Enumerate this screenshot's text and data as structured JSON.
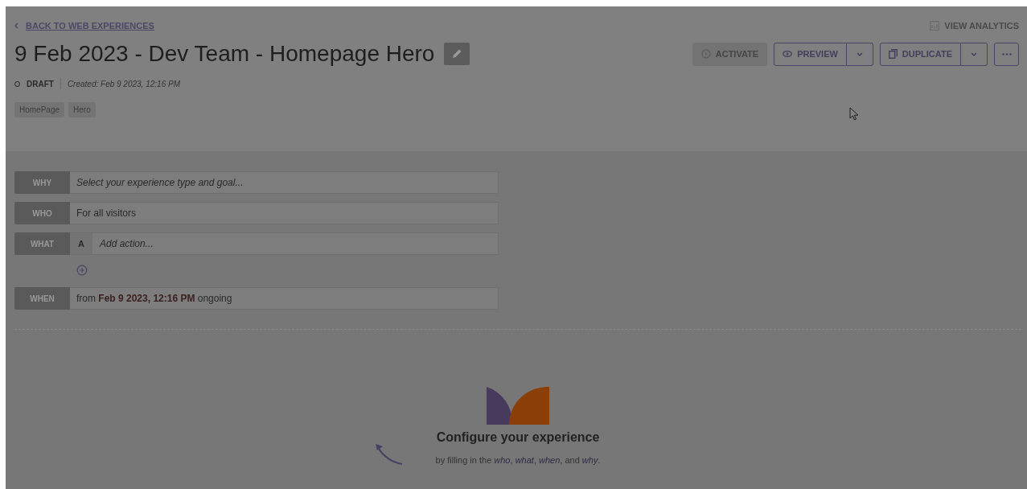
{
  "back_link": "BACK TO WEB EXPERIENCES",
  "view_analytics": "VIEW ANALYTICS",
  "title": "9 Feb 2023 - Dev Team - Homepage Hero",
  "buttons": [
    {
      "kind": "activate",
      "label": "ACTIVATE",
      "disabled": true
    },
    {
      "kind": "preview",
      "label": "PREVIEW",
      "disabled": false
    },
    {
      "kind": "duplicate",
      "label": "DUPLICATE",
      "disabled": false
    },
    {
      "kind": "more",
      "disabled": false
    }
  ],
  "status": {
    "label": "DRAFT",
    "created": "Created: Feb 9 2023, 12:16 PM"
  },
  "tags": [
    "HomePage",
    "Hero"
  ],
  "rows": [
    {
      "kind": "placeholder",
      "label": "WHY",
      "text": "Select your experience type and goal..."
    },
    {
      "kind": "value",
      "label": "WHO",
      "text": "For all visitors"
    },
    {
      "kind": "action",
      "label": "WHAT",
      "badge": "A",
      "text": "Add action..."
    },
    {
      "kind": "add"
    },
    {
      "kind": "value",
      "label": "WHEN",
      "text": "from **Feb 9 2023, 12:16 PM** ongoing"
    }
  ],
  "empty_state": {
    "title": "Configure your experience",
    "text": "by filling in the *who*, *what*, *when*, and *why*."
  }
}
